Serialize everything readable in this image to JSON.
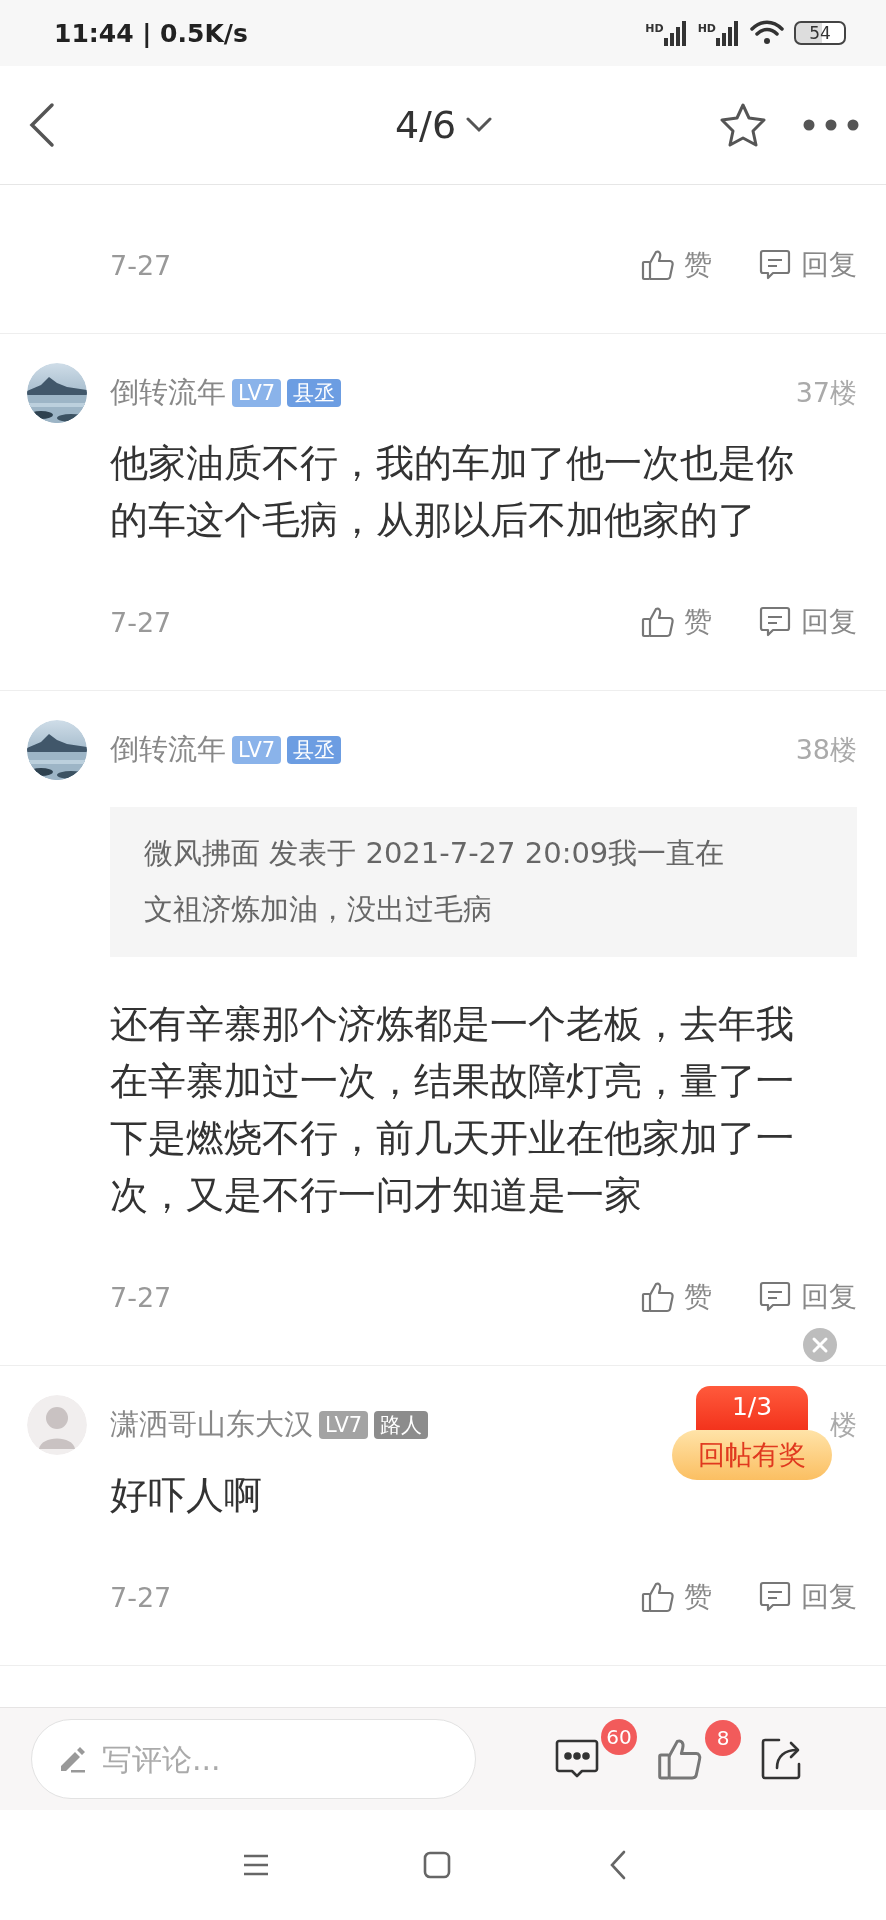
{
  "status_bar": {
    "time": "11:44 | 0.5K/s",
    "signals": [
      {
        "label": "HD"
      },
      {
        "label": "HD"
      }
    ],
    "battery": "54"
  },
  "header": {
    "title": "4/6"
  },
  "posts": [
    {
      "date": "7-27",
      "like": "赞",
      "reply": "回复"
    },
    {
      "author": "倒转流年",
      "tags": [
        {
          "text": "LV7",
          "color": "#8ab3ea"
        },
        {
          "text": "县丞",
          "color": "#6c9de2"
        }
      ],
      "floor": "37楼",
      "content": "他家油质不行，我的车加了他一次也是你的车这个毛病，从那以后不加他家的了",
      "date": "7-27",
      "like": "赞",
      "reply": "回复"
    },
    {
      "author": "倒转流年",
      "tags": [
        {
          "text": "LV7",
          "color": "#8ab3ea"
        },
        {
          "text": "县丞",
          "color": "#6c9de2"
        }
      ],
      "floor": "38楼",
      "quote": "微风拂面 发表于 2021-7-27 20:09我一直在文祖济炼加油，没出过毛病",
      "content": "还有辛寨那个济炼都是一个老板，去年我在辛寨加过一次，结果故障灯亮，量了一下是燃烧不行，前几天开业在他家加了一次，又是不行一问才知道是一家",
      "date": "7-27",
      "like": "赞",
      "reply": "回复"
    },
    {
      "avatar": {
        "kind": "figure"
      },
      "author": "潇洒哥山东大汉",
      "tags": [
        {
          "text": "LV7",
          "color": "#a3a3a3"
        },
        {
          "text": "路人",
          "color": "#8c8c8c"
        }
      ],
      "floor": "楼",
      "content": "好吓人啊",
      "date": "7-27",
      "like": "赞",
      "reply": "回复"
    }
  ],
  "reward_popup": {
    "count": "1/3",
    "label": "回帖有奖"
  },
  "comment_bar": {
    "placeholder": "写评论...",
    "comments_badge": "60",
    "likes_badge": "8"
  }
}
